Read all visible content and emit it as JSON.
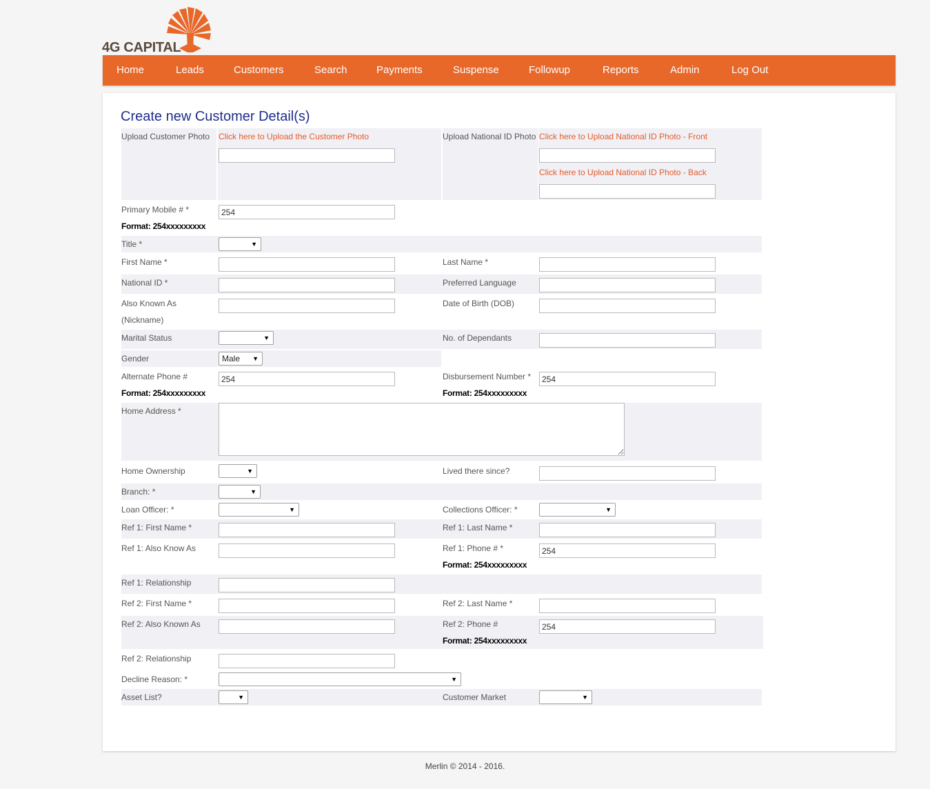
{
  "brand": {
    "name": "4G CAPITAL"
  },
  "nav": [
    {
      "label": "Home"
    },
    {
      "label": "Leads"
    },
    {
      "label": "Customers"
    },
    {
      "label": "Search"
    },
    {
      "label": "Payments"
    },
    {
      "label": "Suspense"
    },
    {
      "label": "Followup"
    },
    {
      "label": "Reports"
    },
    {
      "label": "Admin"
    },
    {
      "label": "Log Out"
    }
  ],
  "page_title": "Create new Customer Detail(s)",
  "form": {
    "upload_customer_photo": {
      "label": "Upload Customer Photo",
      "link": "Click here to Upload the Customer Photo"
    },
    "upload_national_id": {
      "label": "Upload National ID Photo",
      "front_link": "Click here to Upload National ID Photo - Front",
      "back_link": "Click here to Upload National ID Photo - Back"
    },
    "primary_mobile": {
      "label": "Primary Mobile # *",
      "value": "254",
      "format": "Format: 254xxxxxxxxx"
    },
    "title": {
      "label": "Title *",
      "value": ""
    },
    "first_name": {
      "label": "First Name *",
      "value": ""
    },
    "last_name": {
      "label": "Last Name *",
      "value": ""
    },
    "national_id": {
      "label": "National ID *",
      "value": ""
    },
    "preferred_language": {
      "label": "Preferred Language",
      "value": ""
    },
    "also_known_as": {
      "label_line1": "Also Known As",
      "label_line2": "(Nickname)",
      "value": ""
    },
    "dob": {
      "label": "Date of Birth (DOB)",
      "value": ""
    },
    "marital_status": {
      "label": "Marital Status",
      "value": ""
    },
    "dependants": {
      "label": "No. of Dependants",
      "value": ""
    },
    "gender": {
      "label": "Gender",
      "value": "Male"
    },
    "alternate_phone": {
      "label": "Alternate Phone #",
      "value": "254",
      "format": "Format: 254xxxxxxxxx"
    },
    "disbursement_number": {
      "label": "Disbursement Number *",
      "value": "254",
      "format": "Format: 254xxxxxxxxx"
    },
    "home_address": {
      "label": "Home Address *",
      "value": ""
    },
    "home_ownership": {
      "label": "Home Ownership",
      "value": ""
    },
    "lived_since": {
      "label": "Lived there since?",
      "value": ""
    },
    "branch": {
      "label": "Branch: *",
      "value": ""
    },
    "loan_officer": {
      "label": "Loan Officer: *",
      "value": ""
    },
    "collections_officer": {
      "label": "Collections Officer: *",
      "value": ""
    },
    "ref1_first_name": {
      "label": "Ref 1: First Name *",
      "value": ""
    },
    "ref1_last_name": {
      "label": "Ref 1: Last Name *",
      "value": ""
    },
    "ref1_aka": {
      "label": "Ref 1: Also Know As",
      "value": ""
    },
    "ref1_phone": {
      "label": "Ref 1: Phone # *",
      "value": "254",
      "format": "Format: 254xxxxxxxxx"
    },
    "ref1_relationship": {
      "label": "Ref 1: Relationship",
      "value": ""
    },
    "ref2_first_name": {
      "label": "Ref 2: First Name *",
      "value": ""
    },
    "ref2_last_name": {
      "label": "Ref 2: Last Name *",
      "value": ""
    },
    "ref2_aka": {
      "label": "Ref 2: Also Known As",
      "value": ""
    },
    "ref2_phone": {
      "label": "Ref 2: Phone #",
      "value": "254",
      "format": "Format: 254xxxxxxxxx"
    },
    "ref2_relationship": {
      "label": "Ref 2: Relationship",
      "value": ""
    },
    "decline_reason": {
      "label": "Decline Reason: *",
      "value": ""
    },
    "asset_list": {
      "label": "Asset List?",
      "value": ""
    },
    "customer_market": {
      "label": "Customer Market",
      "value": ""
    }
  },
  "footer": "Merlin © 2014 - 2016.",
  "colors": {
    "brand_orange": "#e8682a",
    "link_orange": "#e55a2b",
    "title_blue": "#1f2d8c",
    "band_gray": "#f0f0f5"
  },
  "icons": {
    "logo": "baobab-tree-logo-icon",
    "select": "chevron-down-icon"
  }
}
